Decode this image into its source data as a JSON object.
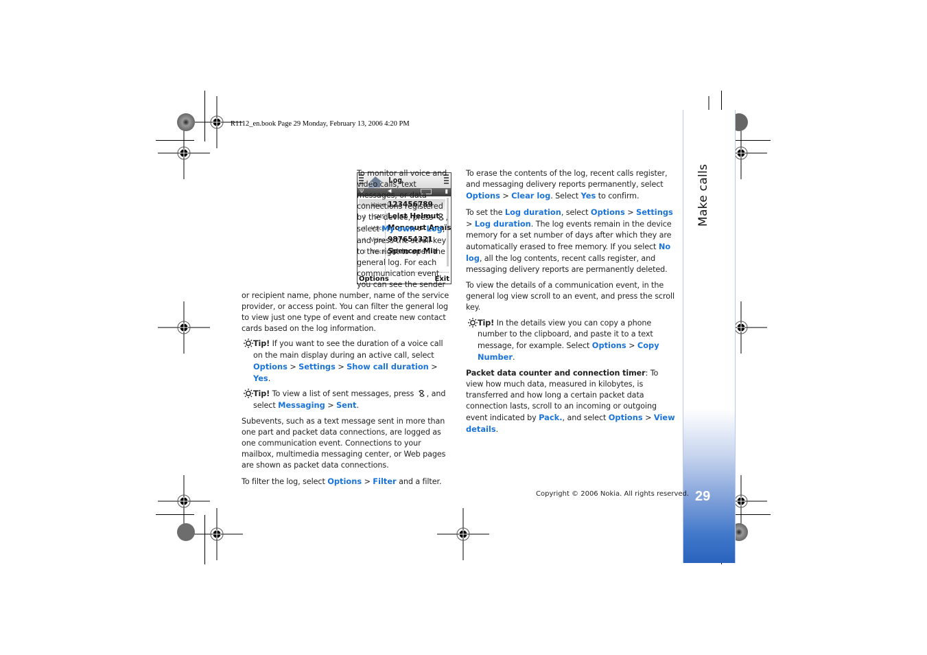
{
  "print_header": "R1112_en.book  Page 29  Monday, February 13, 2006  4:20 PM",
  "section_tab": "Make calls",
  "page_number": "29",
  "copyright": "Copyright © 2006 Nokia. All rights reserved.",
  "colors": {
    "link": "#1a73d8",
    "sidebar_bottom": "#2a63bd"
  },
  "left_column": {
    "intro": {
      "t1": "To monitor all voice and video calls, text messages, or data connections registered by the device, press ",
      "t2": ", select ",
      "l1": "My own",
      "s1": " > ",
      "l2": "Log",
      "t3": ", and press the scroll key to the right to open the general log. For each communication event, you can see the sender or recipient name, phone number, name of the service provider, or access point. You can filter the general log to view just one type of event and create new contact cards based on the log information."
    },
    "tip1": {
      "label": "Tip!",
      "t1": " If you want to see the duration of a voice call on the main display during an active call, select ",
      "l1": "Options",
      "s1": " > ",
      "l2": "Settings",
      "s2": " > ",
      "l3": "Show call duration",
      "s3": " > ",
      "l4": "Yes",
      "t2": "."
    },
    "tip2": {
      "label": "Tip!",
      "t1": " To view a list of sent messages, press ",
      "t2": ", and select ",
      "l1": "Messaging",
      "s1": " > ",
      "l2": "Sent",
      "t3": "."
    },
    "subevents": "Subevents, such as a text message sent in more than one part and packet data connections, are logged as one communication event. Connections to your mailbox, multimedia messaging center, or Web pages are shown as packet data connections.",
    "filter": {
      "t1": "To filter the log, select ",
      "l1": "Options",
      "s1": " > ",
      "l2": "Filter",
      "t2": " and a filter."
    }
  },
  "phone_screen": {
    "title": "Log",
    "rows": [
      {
        "type": "Voice",
        "name": "123456789",
        "direction": "missed",
        "selected": true
      },
      {
        "type": "SMS",
        "name": "Leist Helmut",
        "direction": "incoming"
      },
      {
        "type": "Voice",
        "name": "Moncourt Anaïs",
        "direction": "outgoing"
      },
      {
        "type": "Video",
        "name": "987654321",
        "direction": "incoming"
      },
      {
        "type": "Voice",
        "name": "Spencer Mia",
        "direction": "outgoing"
      }
    ],
    "softkey_left": "Options",
    "softkey_right": "Exit"
  },
  "right_column": {
    "erase": {
      "t1": "To erase the contents of the log, recent calls register, and messaging delivery reports permanently, select ",
      "l1": "Options",
      "s1": " > ",
      "l2": "Clear log",
      "t2": ". Select ",
      "l3": "Yes",
      "t3": " to confirm."
    },
    "duration": {
      "t1": "To set the ",
      "l1": "Log duration",
      "t2": ", select ",
      "l2": "Options",
      "s1": " > ",
      "l3": "Settings",
      "s2": " > ",
      "l4": "Log duration",
      "t3": ". The log events remain in the device memory for a set number of days after which they are automatically erased to free memory. If you select ",
      "l5": "No log",
      "t4": ", all the log contents, recent calls register, and messaging delivery reports are permanently deleted."
    },
    "details": "To view the details of a communication event, in the general log view scroll to an event, and press the scroll key.",
    "tip3": {
      "label": "Tip!",
      "t1": " In the details view you can copy a phone number to the clipboard, and paste it to a text message, for example. Select ",
      "l1": "Options",
      "s1": " > ",
      "l2": "Copy Number",
      "t2": "."
    },
    "packet": {
      "heading": "Packet data counter and connection timer",
      "t1": ": To view how much data, measured in kilobytes, is transferred and how long a certain packet data connection lasts, scroll to an incoming or outgoing event indicated by ",
      "l1": "Pack.",
      "t2": ", and select ",
      "l2": "Options",
      "s1": " > ",
      "l3": "View details",
      "t3": "."
    }
  }
}
